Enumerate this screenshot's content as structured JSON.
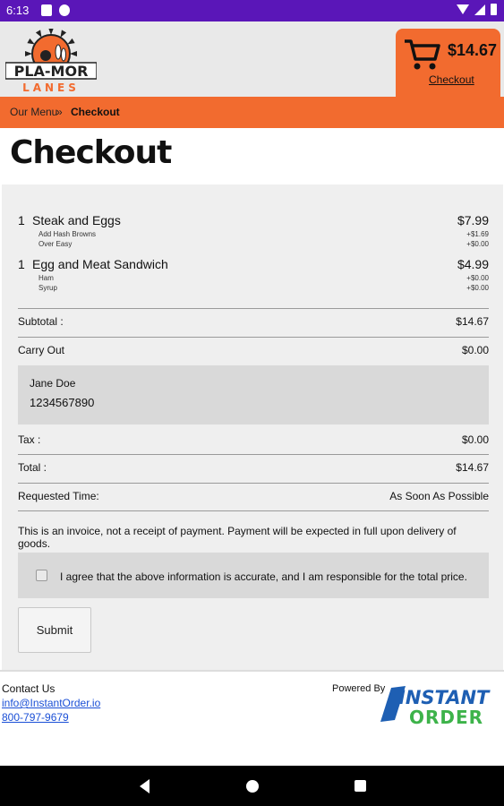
{
  "status_bar": {
    "time": "6:13"
  },
  "header": {
    "logo_text_top": "PLA-MOR",
    "logo_text_bottom": "LANES",
    "cart_total": "$14.67",
    "cart_link": "Checkout"
  },
  "breadcrumb": {
    "menu": "Our Menu",
    "separator": "»",
    "current": "Checkout"
  },
  "page_title": "Checkout",
  "order": {
    "items": [
      {
        "qty": "1",
        "name": "Steak and Eggs",
        "price": "$7.99",
        "modifiers": [
          {
            "name": "Add Hash Browns",
            "price": "+$1.69"
          },
          {
            "name": "Over Easy",
            "price": "+$0.00"
          }
        ]
      },
      {
        "qty": "1",
        "name": "Egg and Meat Sandwich",
        "price": "$4.99",
        "modifiers": [
          {
            "name": "Ham",
            "price": "+$0.00"
          },
          {
            "name": "Syrup",
            "price": "+$0.00"
          }
        ]
      }
    ],
    "subtotal_label": "Subtotal :",
    "subtotal_value": "$14.67",
    "carryout_label": "Carry Out",
    "carryout_value": "$0.00",
    "customer_name": "Jane Doe",
    "customer_phone": "1234567890",
    "tax_label": "Tax :",
    "tax_value": "$0.00",
    "total_label": "Total :",
    "total_value": "$14.67",
    "requested_label": "Requested Time:",
    "requested_value": "As Soon As Possible",
    "invoice_note": "This is an invoice, not a receipt of payment. Payment will be expected in full upon delivery of goods.",
    "agree_text": "I agree that the above information is accurate, and I am responsible for the total price.",
    "submit_label": "Submit"
  },
  "footer": {
    "contact_title": "Contact Us",
    "contact_email": "info@InstantOrder.io",
    "contact_phone": "800-797-9679",
    "powered_by": "Powered By",
    "brand_line1": "INSTANT",
    "brand_line2": "ORDER"
  },
  "colors": {
    "accent": "#f26b2f",
    "status_bar": "#5a16b8",
    "panel": "#efefef",
    "box": "#d9d9d9",
    "link": "#1a4fd6",
    "brand_blue": "#1e5fb3",
    "brand_green": "#3db34a"
  }
}
